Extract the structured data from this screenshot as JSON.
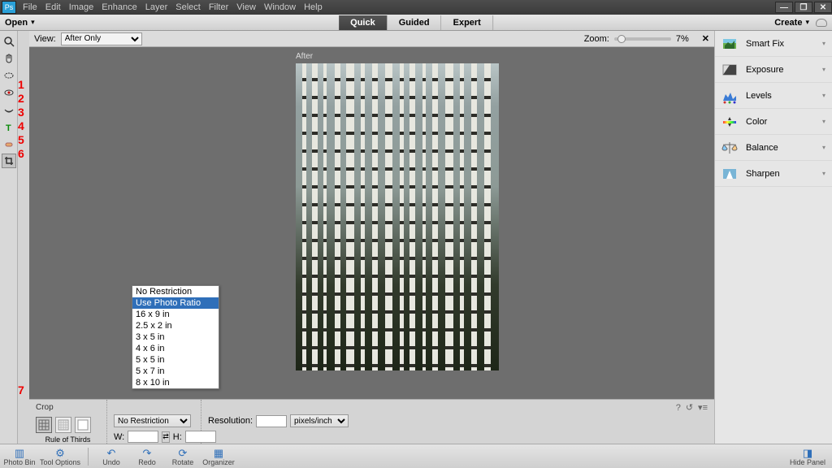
{
  "menubar": [
    "File",
    "Edit",
    "Image",
    "Enhance",
    "Layer",
    "Select",
    "Filter",
    "View",
    "Window",
    "Help"
  ],
  "openbar": {
    "open": "Open",
    "modes": [
      "Quick",
      "Guided",
      "Expert"
    ],
    "active_mode": "Quick",
    "create": "Create"
  },
  "viewbar": {
    "view_label": "View:",
    "view_value": "After Only",
    "zoom_label": "Zoom:",
    "zoom_value": "7%"
  },
  "canvas": {
    "after_label": "After"
  },
  "tool_annotations": [
    "1",
    "2",
    "3",
    "4",
    "5",
    "6"
  ],
  "tool_annotation_7": "7",
  "right_panel": [
    {
      "name": "smart-fix",
      "label": "Smart Fix"
    },
    {
      "name": "exposure",
      "label": "Exposure"
    },
    {
      "name": "levels",
      "label": "Levels"
    },
    {
      "name": "color",
      "label": "Color"
    },
    {
      "name": "balance",
      "label": "Balance"
    },
    {
      "name": "sharpen",
      "label": "Sharpen"
    }
  ],
  "crop_popup": {
    "options": [
      "No Restriction",
      "Use Photo Ratio",
      "16 x 9 in",
      "2.5 x 2 in",
      "3 x 5 in",
      "4 x 6 in",
      "5 x 5 in",
      "5 x 7 in",
      "8 x 10 in"
    ],
    "highlighted": "Use Photo Ratio"
  },
  "options_bar": {
    "title": "Crop",
    "rule_label": "Rule of Thirds",
    "preset_value": "No Restriction",
    "w_label": "W:",
    "h_label": "H:",
    "res_label": "Resolution:",
    "res_unit": "pixels/inch"
  },
  "bottombar": {
    "items": [
      {
        "name": "photo-bin",
        "label": "Photo Bin"
      },
      {
        "name": "tool-options",
        "label": "Tool Options"
      },
      {
        "name": "undo",
        "label": "Undo"
      },
      {
        "name": "redo",
        "label": "Redo"
      },
      {
        "name": "rotate",
        "label": "Rotate"
      },
      {
        "name": "organizer",
        "label": "Organizer"
      }
    ],
    "hide_panel": "Hide Panel"
  }
}
